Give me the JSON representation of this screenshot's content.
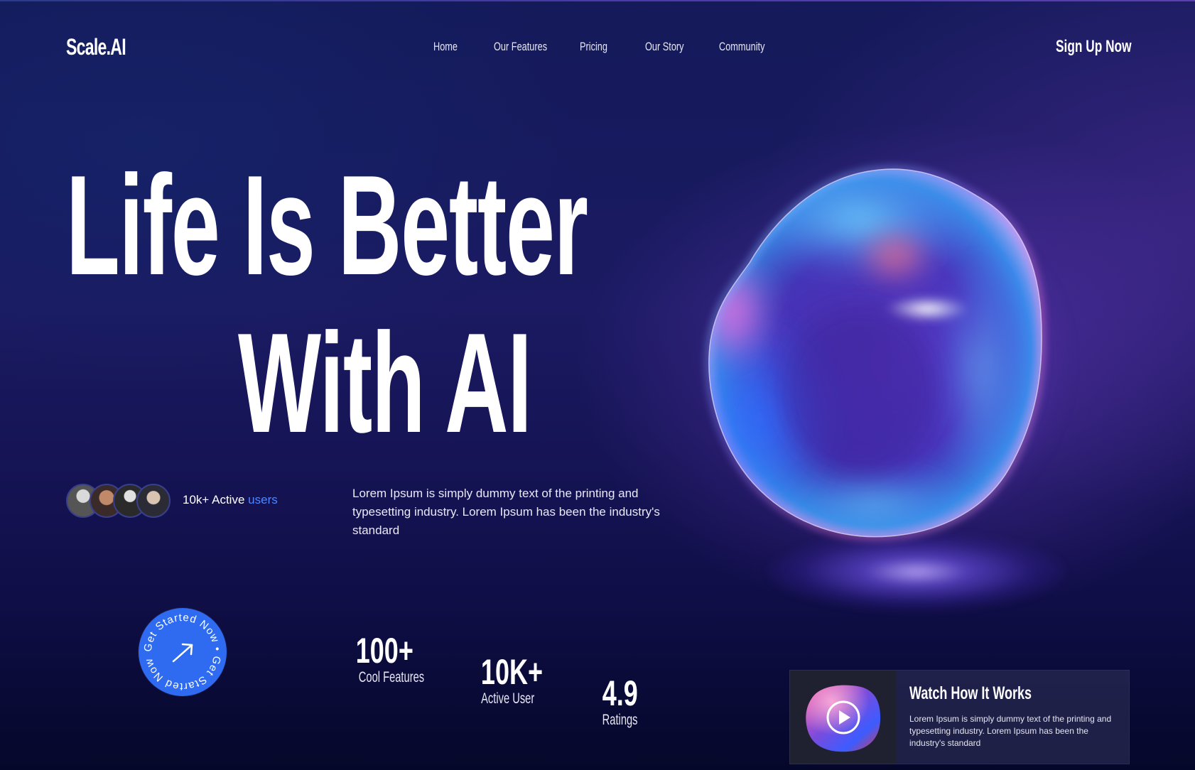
{
  "brand": {
    "logo": "Scale.AI"
  },
  "nav": {
    "items": [
      {
        "label": "Home"
      },
      {
        "label": "Our Features"
      },
      {
        "label": "Pricing"
      },
      {
        "label": "Our Story"
      },
      {
        "label": "Community"
      }
    ],
    "signup_label": "Sign Up Now"
  },
  "hero": {
    "headline_line1": "Life Is Better",
    "headline_line2": "With AI",
    "users_text": "10k+ Active",
    "users_accent": "users",
    "description": "Lorem Ipsum is simply dummy text of the printing and typesetting industry. Lorem Ipsum has been the industry's standard"
  },
  "cta": {
    "ring_text": "Get Started Now • Get Started Now • "
  },
  "stats": [
    {
      "value": "100+",
      "label": "Cool Features"
    },
    {
      "value": "10K+",
      "label": "Active User"
    },
    {
      "value": "4.9",
      "label": "Ratings"
    }
  ],
  "video": {
    "title": "Watch How It Works",
    "description": "Lorem Ipsum is simply dummy text of the printing and typesetting industry. Lorem Ipsum has been the industry's standard"
  },
  "colors": {
    "accent": "#2e6bf0",
    "accent_text": "#4f86ff",
    "background_dark": "#0a0c36"
  }
}
